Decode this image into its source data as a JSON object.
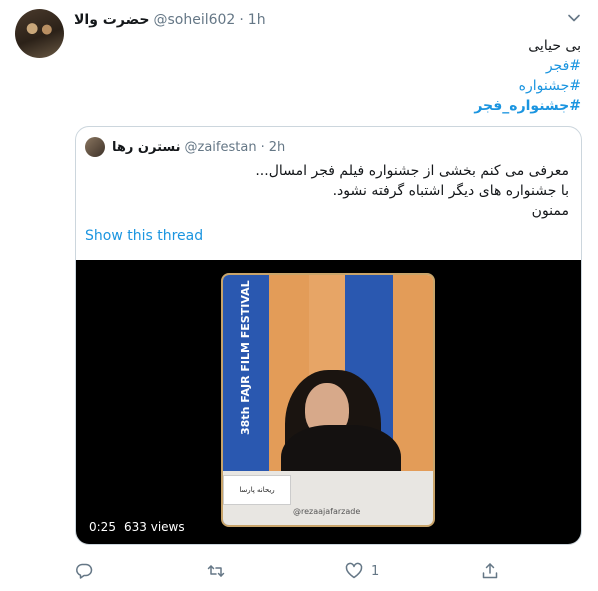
{
  "tweet": {
    "author_name": "حضرت والا",
    "author_handle": "@soheil602",
    "separator": "·",
    "time": "1h",
    "lines": [
      "بی حیایی"
    ],
    "hashtags": [
      "#فجر",
      "#جشنواره",
      "#جشنواره_فجر"
    ]
  },
  "quote": {
    "author_name": "نسترن رها",
    "author_handle": "@zaifestan",
    "separator": "·",
    "time": "2h",
    "lines": [
      "معرفی می کنم بخشی از جشنواره فیلم فجر امسال...",
      "با جشنواره های دیگر اشتباه گرفته نشود.",
      "ممنون"
    ],
    "show_thread": "Show this thread"
  },
  "video": {
    "duration": "0:25",
    "views": "633 views",
    "festival_label": "38th FAJR FILM FESTIVAL",
    "nameplate": "ریحانه پارسا",
    "watermark": "@rezaajafarzade"
  },
  "actions": {
    "reply_count": "",
    "retweet_count": "",
    "like_count": "1"
  },
  "icons": {
    "menu": "chevron-down-icon",
    "reply": "reply-icon",
    "retweet": "retweet-icon",
    "like": "heart-icon",
    "share": "share-icon"
  },
  "colors": {
    "link": "#1b95e0",
    "secondary": "#657786",
    "border": "#ccd6dd"
  }
}
